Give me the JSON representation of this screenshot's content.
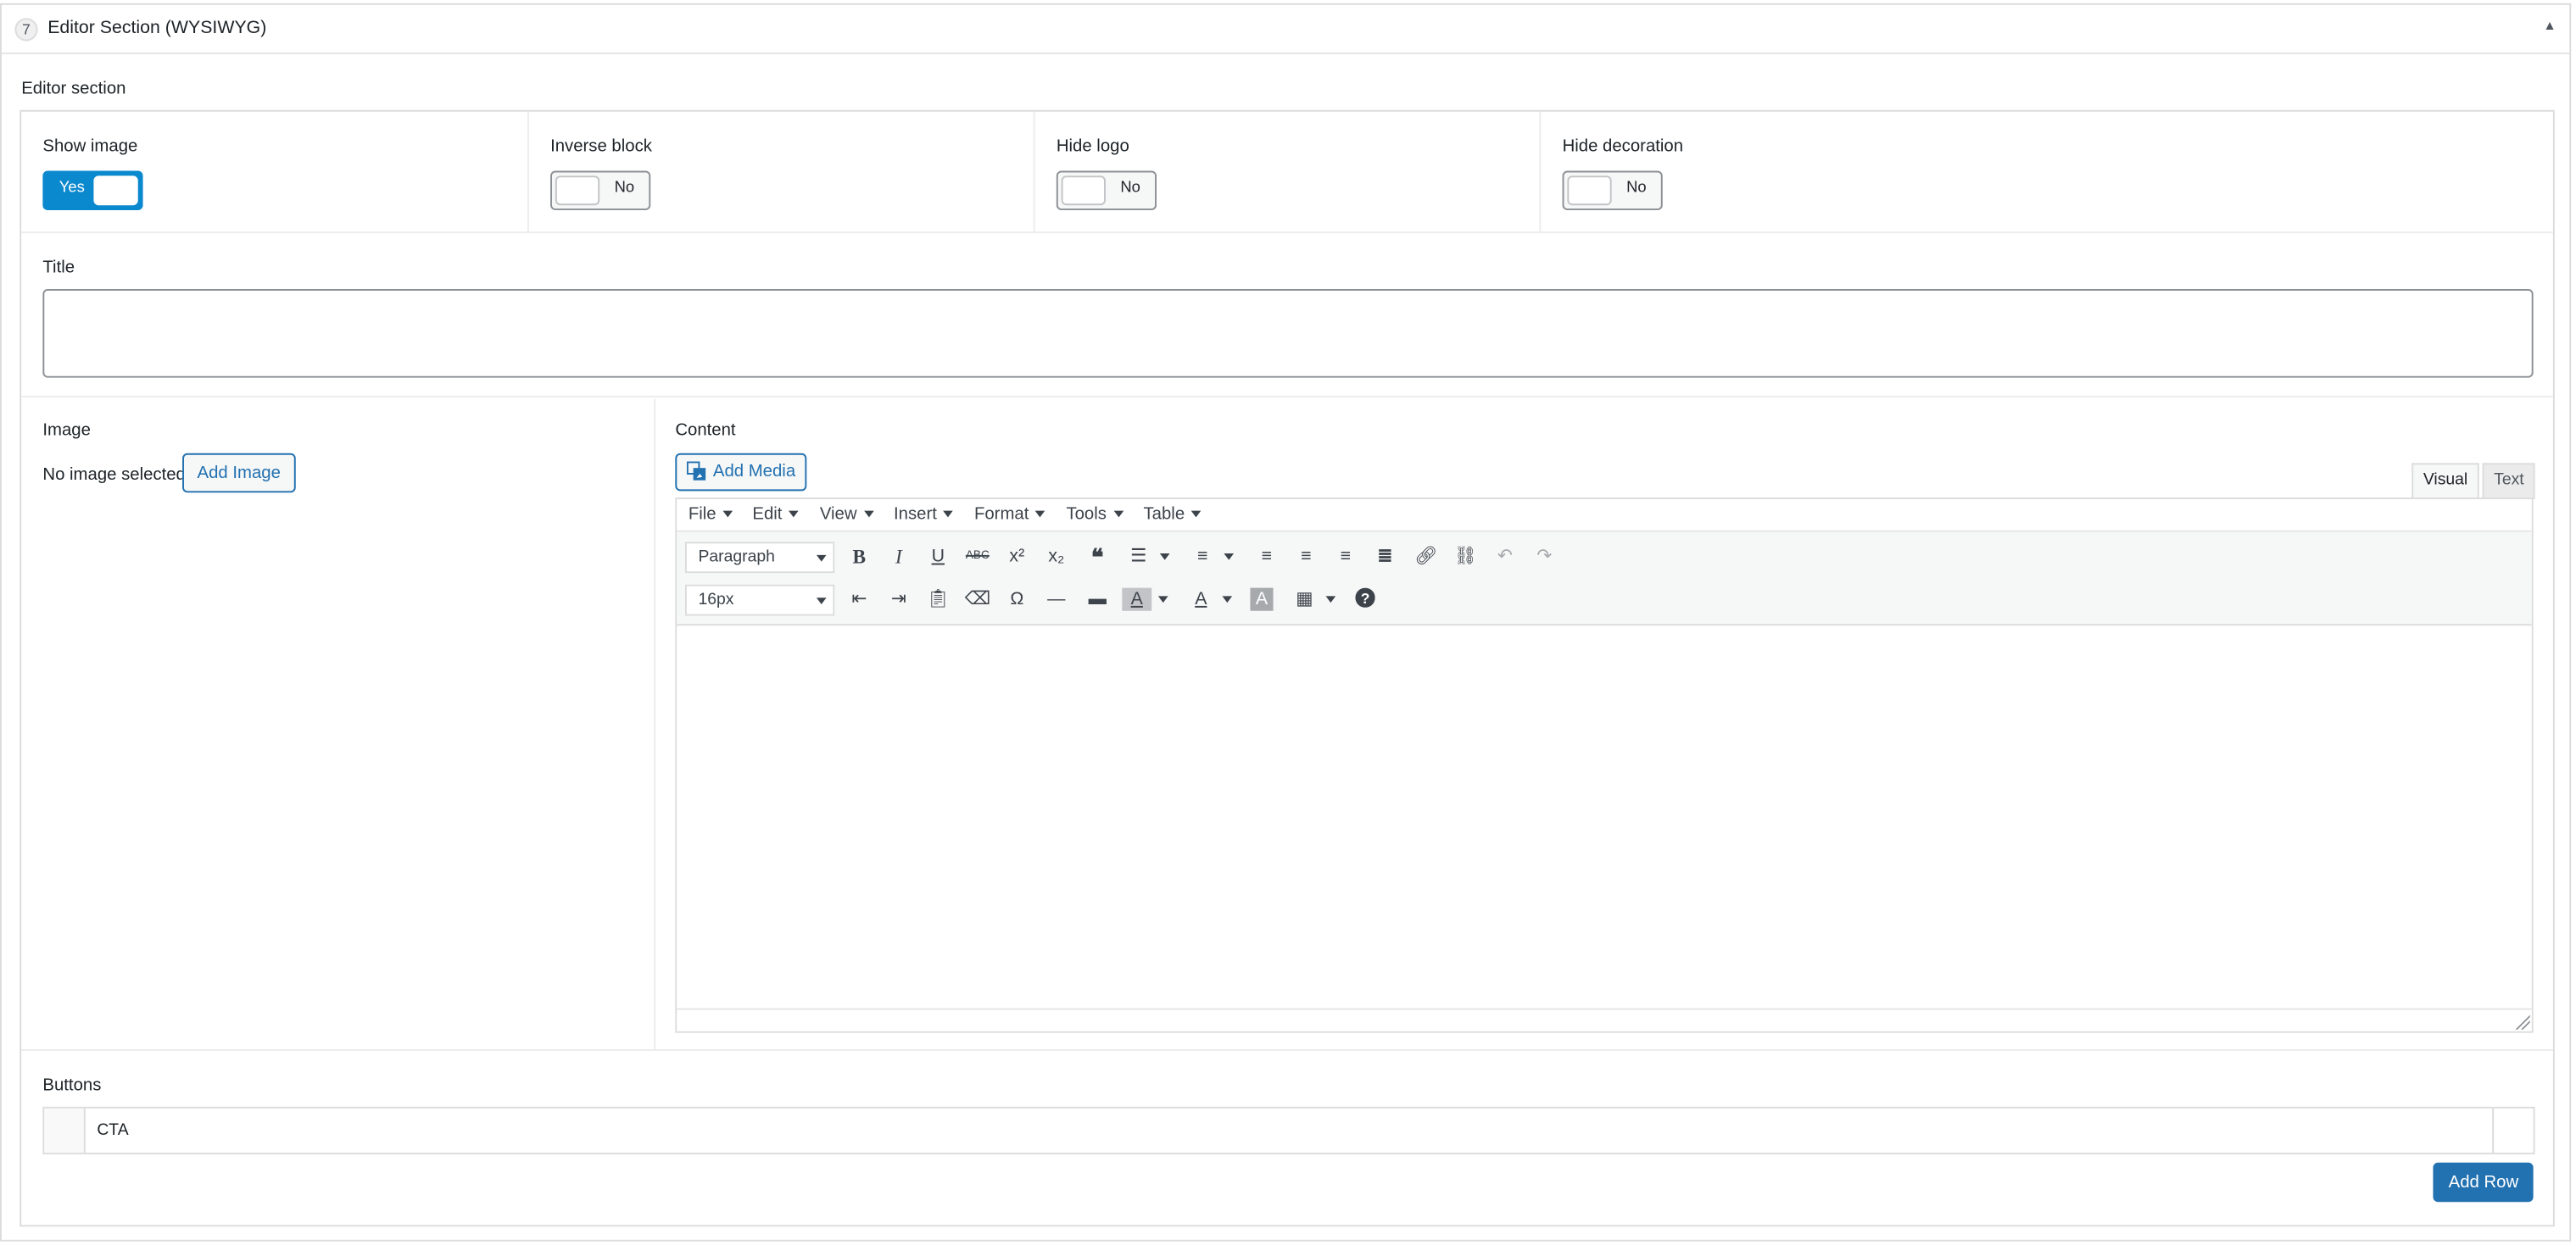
{
  "header": {
    "number": "7",
    "title": "Editor Section (WYSIWYG)",
    "collapse_icon": "caret-up-icon"
  },
  "section_label": "Editor section",
  "toggles": [
    {
      "label": "Show image",
      "state": "Yes",
      "on": true
    },
    {
      "label": "Inverse block",
      "state": "No",
      "on": false
    },
    {
      "label": "Hide logo",
      "state": "No",
      "on": false
    },
    {
      "label": "Hide decoration",
      "state": "No",
      "on": false
    }
  ],
  "title_field": {
    "label": "Title",
    "value": ""
  },
  "image_field": {
    "label": "Image",
    "status": "No image selected",
    "add_button": "Add Image"
  },
  "content_field": {
    "label": "Content",
    "add_media": "Add Media",
    "tabs": {
      "visual": "Visual",
      "text": "Text"
    },
    "menu": [
      "File",
      "Edit",
      "View",
      "Insert",
      "Format",
      "Tools",
      "Table"
    ],
    "block_format": "Paragraph",
    "font_size": "16px",
    "toolbar_icons": [
      "bold-icon",
      "italic-icon",
      "underline-icon",
      "strikethrough-icon",
      "superscript-icon",
      "subscript-icon",
      "blockquote-icon",
      "bullet-list-icon",
      "numbered-list-icon",
      "align-left-icon",
      "align-center-icon",
      "align-right-icon",
      "align-justify-icon",
      "link-icon",
      "unlink-icon",
      "undo-icon",
      "redo-icon",
      "outdent-icon",
      "indent-icon",
      "paste-text-icon",
      "clear-formatting-icon",
      "special-character-icon",
      "horizontal-line-icon",
      "page-break-icon",
      "background-color-icon",
      "text-color-icon",
      "highlight-icon",
      "table-icon",
      "help-icon"
    ]
  },
  "buttons_field": {
    "label": "Buttons",
    "rows": [
      "CTA"
    ],
    "add_row": "Add Row"
  },
  "colors": {
    "primary": "#2271b1",
    "toggle_on": "#0b89cf",
    "border": "#dcdcde"
  }
}
